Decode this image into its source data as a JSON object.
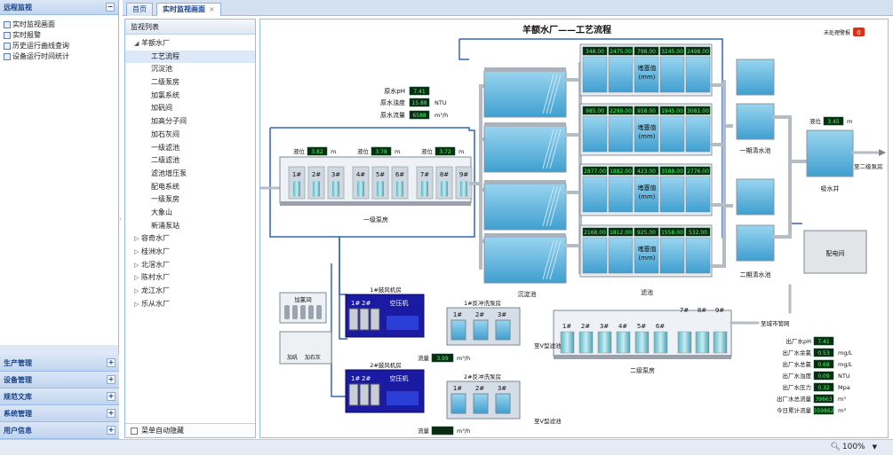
{
  "sidebar": {
    "monitor_title": "远程监视",
    "nav": [
      {
        "label": "实时监视画面",
        "icon": "monitor-screen-icon"
      },
      {
        "label": "实时报警",
        "icon": "alarm-list-icon"
      },
      {
        "label": "历史运行曲线查询",
        "icon": "history-curve-icon"
      },
      {
        "label": "设备运行时间统计",
        "icon": "runtime-stats-icon"
      }
    ],
    "sections": [
      "生产管理",
      "设备管理",
      "规范文库",
      "系统管理",
      "用户信息"
    ],
    "collapse_glyph": "−",
    "expand_glyph": "+"
  },
  "tabs": [
    {
      "label": "首页"
    },
    {
      "label": "实时监视画面",
      "close": "×"
    }
  ],
  "tree": {
    "title": "监视列表",
    "nodes": [
      {
        "label": "羊额水厂",
        "arrow": "◢",
        "level": 0
      },
      {
        "label": "工艺流程",
        "level": 1,
        "selected": true
      },
      {
        "label": "沉淀池",
        "level": 1
      },
      {
        "label": "二级泵房",
        "level": 1
      },
      {
        "label": "加氯系统",
        "level": 1
      },
      {
        "label": "加矾间",
        "level": 1
      },
      {
        "label": "加高分子间",
        "level": 1
      },
      {
        "label": "加石灰间",
        "level": 1
      },
      {
        "label": "一级滤池",
        "level": 1
      },
      {
        "label": "二级滤池",
        "level": 1
      },
      {
        "label": "滤池增压泵",
        "level": 1
      },
      {
        "label": "配电系统",
        "level": 1
      },
      {
        "label": "一级泵房",
        "level": 1
      },
      {
        "label": "大象山",
        "level": 1
      },
      {
        "label": "新涌泵站",
        "level": 1
      },
      {
        "label": "容奇水厂",
        "arrow": "▷",
        "level": 0
      },
      {
        "label": "桂洲水厂",
        "arrow": "▷",
        "level": 0
      },
      {
        "label": "北滘水厂",
        "arrow": "▷",
        "level": 0
      },
      {
        "label": "陈村水厂",
        "arrow": "▷",
        "level": 0
      },
      {
        "label": "龙江水厂",
        "arrow": "▷",
        "level": 0
      },
      {
        "label": "乐从水厂",
        "arrow": "▷",
        "level": 0
      }
    ],
    "footer": "菜单自动隐藏"
  },
  "diagram": {
    "title": "羊额水厂——工艺流程",
    "alarm_label": "未处理警报",
    "alarm_count": "0",
    "raw_water": {
      "ph_label": "原水pH",
      "ph_value": "7.41",
      "turb_label": "原水浊度",
      "turb_value": "15.88",
      "turb_unit": "NTU",
      "flow_label": "原水流量",
      "flow_value": "6588",
      "flow_unit": "m³/h"
    },
    "pump1": {
      "levels": [
        {
          "label": "液位",
          "value": "3.82",
          "unit": "m"
        },
        {
          "label": "液位",
          "value": "3.78",
          "unit": "m"
        },
        {
          "label": "液位",
          "value": "3.72",
          "unit": "m"
        }
      ],
      "pumps": [
        "1#",
        "2#",
        "3#",
        "4#",
        "5#",
        "6#",
        "7#",
        "8#",
        "9#"
      ],
      "name": "一级泵房"
    },
    "sedimentation_label": "沉淀池",
    "filter_label": "滤池",
    "filter_rows": [
      {
        "values": [
          "348.00",
          "2475.00",
          "798.00",
          "3245.00",
          "2498.00"
        ]
      },
      {
        "values": [
          "985.00",
          "2299.00",
          "958.00",
          "1945.00",
          "3081.00"
        ]
      },
      {
        "values": [
          "2877.00",
          "1882.00",
          "423.00",
          "3588.00",
          "2776.00"
        ]
      },
      {
        "values": [
          "2168.00",
          "1812.00",
          "925.00",
          "1558.00",
          "532.00"
        ]
      }
    ],
    "filter_overlay_l1": "堵塞值",
    "filter_overlay_l2": "(mm)",
    "clearwell1_label": "一期清水池",
    "clearwell2_label": "二期清水池",
    "suction_well": {
      "level_label": "液位",
      "level_value": "3.45",
      "level_unit": "m",
      "name": "吸水井"
    },
    "to_pump2_label": "至二级泵房",
    "power_room_label": "配电间",
    "chlorine_room_label": "加氯间",
    "dosing_label_1": "加矾",
    "dosing_label_2": "加石灰",
    "blower1": {
      "title": "1#鼓风机房",
      "units": [
        "1#",
        "2#"
      ],
      "compressor": "空压机"
    },
    "blower2": {
      "title": "2#鼓风机房",
      "units": [
        "1#",
        "2#"
      ],
      "compressor": "空压机"
    },
    "backwash1": {
      "title": "1#反冲洗泵房",
      "units": [
        "1#",
        "2#",
        "3#"
      ]
    },
    "backwash2": {
      "title": "2#反冲洗泵房",
      "units": [
        "1#",
        "2#",
        "3#"
      ]
    },
    "v_filter_1": "至V型滤池",
    "v_filter_2": "至V型滤池",
    "flow_label": "流量",
    "flow_unit": "m³/h",
    "flow1_value": "3.99",
    "flow2_value": "",
    "pump2": {
      "name": "二级泵房",
      "pumps": [
        "1#",
        "2#",
        "3#",
        "4#",
        "5#",
        "6#",
        "7#",
        "8#",
        "9#"
      ],
      "to_city": "至城市管网"
    },
    "outlet": [
      {
        "label": "出厂水pH",
        "value": "7.41",
        "unit": ""
      },
      {
        "label": "出厂水余氯",
        "value": "0.53",
        "unit": "mg/L"
      },
      {
        "label": "出厂水总氯",
        "value": "0.68",
        "unit": "mg/L"
      },
      {
        "label": "出厂水浊度",
        "value": "0.09",
        "unit": "NTU"
      },
      {
        "label": "出厂水压力",
        "value": "0.32",
        "unit": "Mpa"
      },
      {
        "label": "出厂水总流量",
        "value": "39663",
        "unit": "m³"
      },
      {
        "label": "今日累计流量",
        "value": "359862",
        "unit": "m³"
      }
    ]
  },
  "status": {
    "zoom_icon": "zoom-magnifier-icon",
    "zoom": "100%"
  },
  "colors": {
    "sidebar_bg": "#dfe8f6",
    "panel_border": "#99bbe8",
    "header_text": "#15428b",
    "pipe": "#b6bcc4",
    "flow_line": "#3465b3",
    "water": "#6bbde4",
    "blower_bg": "#1a1aa3",
    "lcd_bg": "#0a2d12",
    "lcd_text": "#3dff6c",
    "alarm": "#d9301a"
  }
}
